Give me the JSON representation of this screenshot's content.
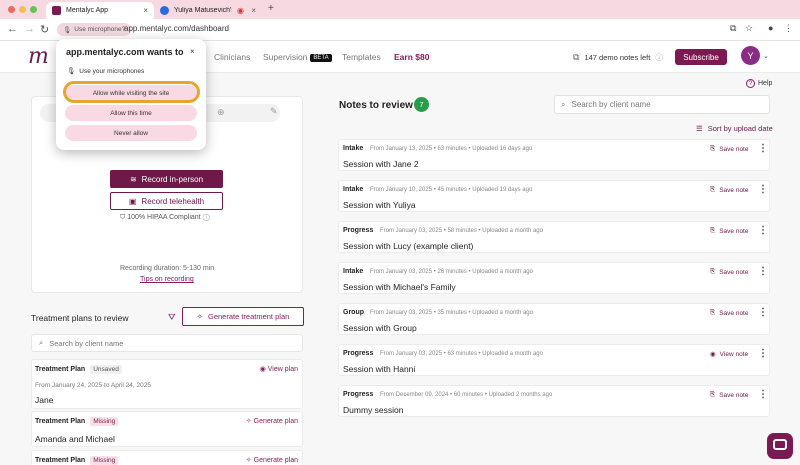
{
  "browser": {
    "tabs": [
      {
        "title": "Mentalyc App",
        "active": true
      },
      {
        "title": "Yuliya Matusevich's Zoom",
        "active": false
      }
    ],
    "new_tab": "+",
    "permission_chip": "Use microphone?",
    "url": "app.mentalyc.com/dashboard"
  },
  "permission_popup": {
    "title": "app.mentalyc.com wants to",
    "close": "×",
    "request": "Use your microphones",
    "options": [
      "Allow while visiting the site",
      "Allow this time",
      "Never allow"
    ]
  },
  "header": {
    "logo": "m",
    "nav": {
      "clinicians": "Clinicians",
      "supervision": "Supervision",
      "supervision_badge": "BETA",
      "templates": "Templates",
      "earn": "Earn $80"
    },
    "demo_notes": "147 demo notes left",
    "subscribe": "Subscribe",
    "avatar_initial": "Y"
  },
  "help": "Help",
  "recorder": {
    "record_in_person": "Record in-person",
    "record_telehealth": "Record telehealth",
    "hipaa": "100% HIPAA Compliant",
    "duration": "Recording duration: 5-130 min",
    "tips": "Tips on recording"
  },
  "treatment_plans": {
    "title": "Treatment plans to review",
    "generate": "Generate treatment plan",
    "search_placeholder": "Search by client name",
    "items": [
      {
        "label": "Treatment Plan",
        "badge": "Unsaved",
        "action": "View plan",
        "dates": "From January 24, 2025 to April 24, 2025",
        "name": "Jane"
      },
      {
        "label": "Treatment Plan",
        "badge": "Missing",
        "action": "Generate plan",
        "name": "Amanda and Michael"
      },
      {
        "label": "Treatment Plan",
        "badge": "Missing",
        "action": "Generate plan"
      }
    ]
  },
  "notes": {
    "title": "Notes to review",
    "count": "7",
    "search_placeholder": "Search by client name",
    "sort": "Sort by upload date",
    "items": [
      {
        "type": "Intake",
        "meta": "From January 13, 2025 • 63 minutes • Uploaded 16 days ago",
        "title": "Session with Jane 2",
        "action": "Save note"
      },
      {
        "type": "Intake",
        "meta": "From January 10, 2025 • 45 minutes • Uploaded 19 days ago",
        "title": "Session with Yuliya",
        "action": "Save note"
      },
      {
        "type": "Progress",
        "meta": "From January 03, 2025 • 58 minutes • Uploaded a month ago",
        "title": "Session with Lucy (example client)",
        "action": "Save note"
      },
      {
        "type": "Intake",
        "meta": "From January 03, 2025 • 26 minutes • Uploaded a month ago",
        "title": "Session with Michael's Family",
        "action": "Save note"
      },
      {
        "type": "Group",
        "meta": "From January 03, 2025 • 35 minutes • Uploaded a month ago",
        "title": "Session with Group",
        "action": "Save note"
      },
      {
        "type": "Progress",
        "meta": "From January 03, 2025 • 63 minutes • Uploaded a month ago",
        "title": "Session with Hanni",
        "action": "View note"
      },
      {
        "type": "Progress",
        "meta": "From December 09, 2024 • 60 minutes • Uploaded 2 months ago",
        "title": "Dummy session",
        "action": "Save note"
      }
    ]
  },
  "colors": {
    "brand": "#7b1a52",
    "accent_pink": "#f9dae4",
    "focus": "#e8a42e",
    "count_badge": "#2a9a4b"
  }
}
